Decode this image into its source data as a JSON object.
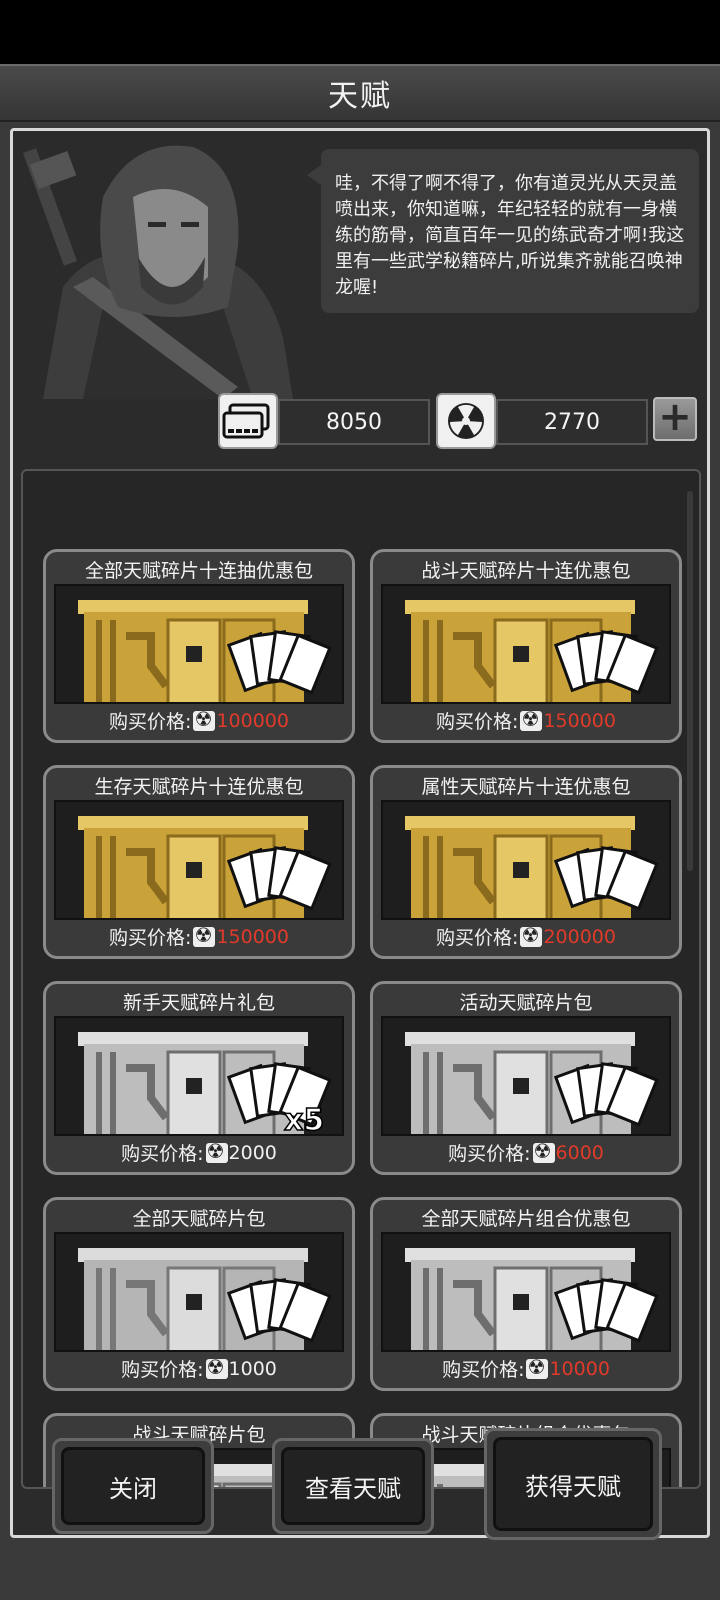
{
  "window": {
    "title": "天赋"
  },
  "npc": {
    "dialogue": "哇，不得了啊不得了，你有道灵光从天灵盖喷出来，你知道嘛，年纪轻轻的就有一身横练的筋骨，简直百年一见的练武奇才啊!我这里有一些武学秘籍碎片,听说集齐就能召唤神龙喔!"
  },
  "currencies": [
    {
      "icon": "cash-card-icon",
      "value": "8050"
    },
    {
      "icon": "radiation-icon",
      "value": "2770"
    }
  ],
  "add_label": "+",
  "shop": {
    "price_label": "购买价格:",
    "items": [
      {
        "title": "全部天赋碎片十连抽优惠包",
        "price": "100000",
        "price_color": "#e03a2a",
        "tier": "gold",
        "badge": ""
      },
      {
        "title": "战斗天赋碎片十连优惠包",
        "price": "150000",
        "price_color": "#e03a2a",
        "tier": "gold",
        "badge": ""
      },
      {
        "title": "生存天赋碎片十连优惠包",
        "price": "150000",
        "price_color": "#e03a2a",
        "tier": "gold",
        "badge": ""
      },
      {
        "title": "属性天赋碎片十连优惠包",
        "price": "200000",
        "price_color": "#e03a2a",
        "tier": "gold",
        "badge": ""
      },
      {
        "title": "新手天赋碎片礼包",
        "price": "2000",
        "price_color": "#f0f0f0",
        "tier": "silver",
        "badge": "x5"
      },
      {
        "title": "活动天赋碎片包",
        "price": "6000",
        "price_color": "#e03a2a",
        "tier": "silver",
        "badge": ""
      },
      {
        "title": "全部天赋碎片包",
        "price": "1000",
        "price_color": "#f0f0f0",
        "tier": "plain",
        "badge": ""
      },
      {
        "title": "全部天赋碎片组合优惠包",
        "price": "10000",
        "price_color": "#e03a2a",
        "tier": "silver",
        "badge": ""
      },
      {
        "title": "战斗天赋碎片包",
        "price": "",
        "price_color": "#f0f0f0",
        "tier": "silver",
        "badge": ""
      },
      {
        "title": "战斗天赋碎片组合优惠包",
        "price": "",
        "price_color": "#f0f0f0",
        "tier": "silver",
        "badge": ""
      }
    ]
  },
  "buttons": {
    "close": "关闭",
    "view": "查看天赋",
    "get": "获得天赋"
  }
}
